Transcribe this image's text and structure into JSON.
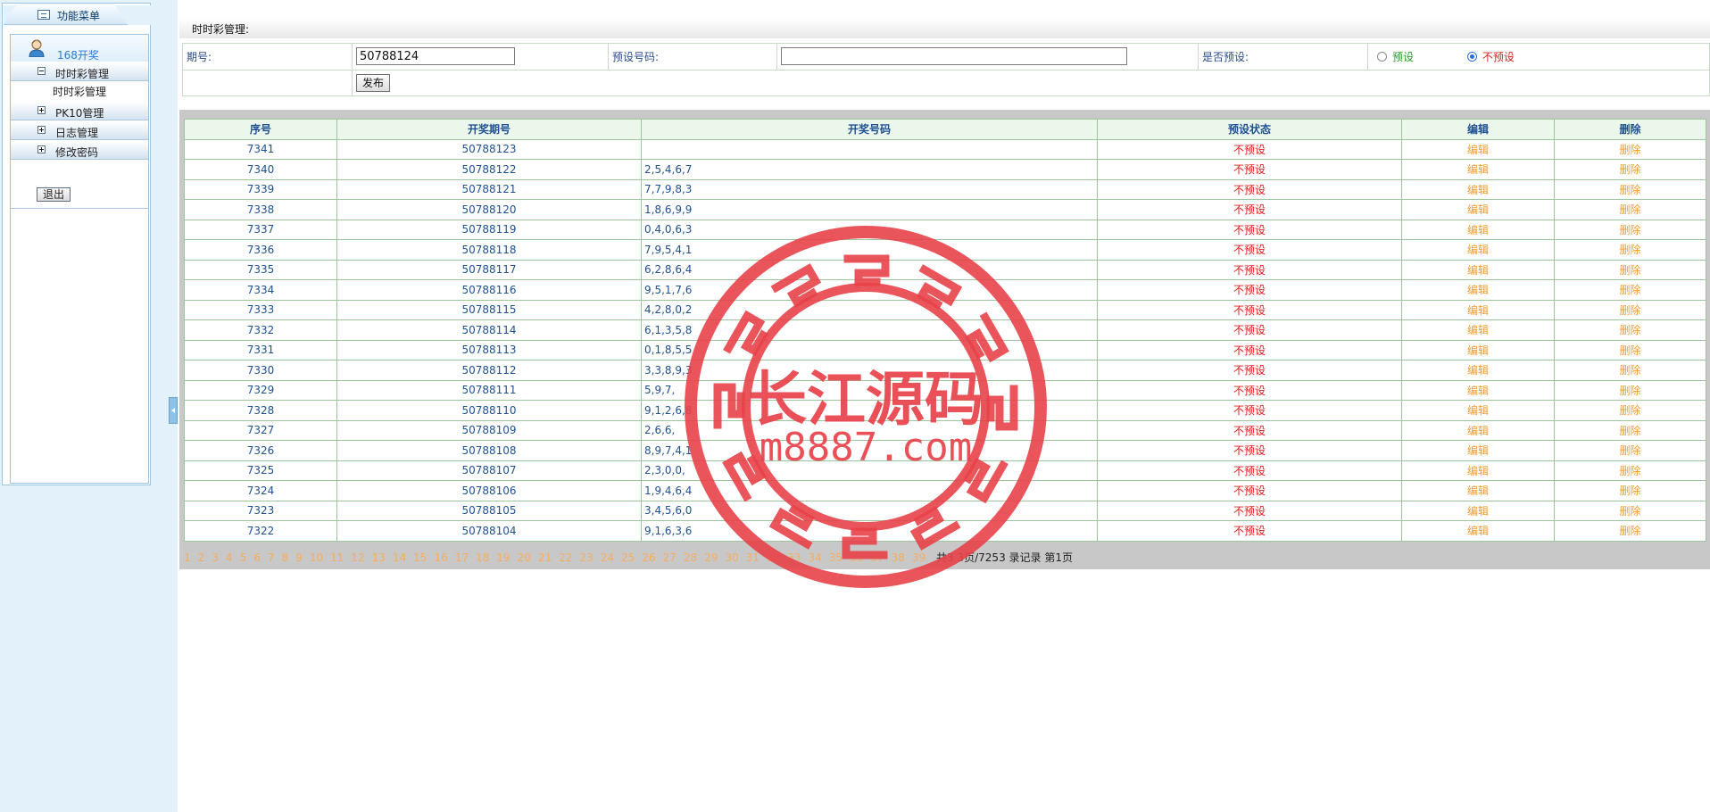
{
  "sidebar": {
    "title": "功能菜单",
    "user": "168开奖",
    "sections": [
      {
        "label": "时时彩管理",
        "expanded": true,
        "children": [
          "时时彩管理"
        ]
      },
      {
        "label": "PK10管理",
        "expanded": false
      },
      {
        "label": "日志管理",
        "expanded": false
      },
      {
        "label": "修改密码",
        "expanded": false
      }
    ],
    "logout": "退出"
  },
  "page": {
    "title": "时时彩管理:"
  },
  "form": {
    "issue_label": "期号:",
    "issue_value": "50788124",
    "preset_label": "预设号码:",
    "preset_value": "",
    "is_preset_label": "是否预设:",
    "radio_yes": "预设",
    "radio_no": "不预设",
    "selected": "不预设",
    "publish": "发布"
  },
  "table": {
    "headers": [
      "序号",
      "开奖期号",
      "开奖号码",
      "预设状态",
      "编辑",
      "删除"
    ],
    "rows": [
      {
        "id": "7341",
        "issue": "50788123",
        "nums": "",
        "status": "不预设",
        "edit": "编辑",
        "del": "删除"
      },
      {
        "id": "7340",
        "issue": "50788122",
        "nums": "2,5,4,6,7",
        "status": "不预设",
        "edit": "编辑",
        "del": "删除"
      },
      {
        "id": "7339",
        "issue": "50788121",
        "nums": "7,7,9,8,3",
        "status": "不预设",
        "edit": "编辑",
        "del": "删除"
      },
      {
        "id": "7338",
        "issue": "50788120",
        "nums": "1,8,6,9,9",
        "status": "不预设",
        "edit": "编辑",
        "del": "删除"
      },
      {
        "id": "7337",
        "issue": "50788119",
        "nums": "0,4,0,6,3",
        "status": "不预设",
        "edit": "编辑",
        "del": "删除"
      },
      {
        "id": "7336",
        "issue": "50788118",
        "nums": "7,9,5,4,1",
        "status": "不预设",
        "edit": "编辑",
        "del": "删除"
      },
      {
        "id": "7335",
        "issue": "50788117",
        "nums": "6,2,8,6,4",
        "status": "不预设",
        "edit": "编辑",
        "del": "删除"
      },
      {
        "id": "7334",
        "issue": "50788116",
        "nums": "9,5,1,7,6",
        "status": "不预设",
        "edit": "编辑",
        "del": "删除"
      },
      {
        "id": "7333",
        "issue": "50788115",
        "nums": "4,2,8,0,2",
        "status": "不预设",
        "edit": "编辑",
        "del": "删除"
      },
      {
        "id": "7332",
        "issue": "50788114",
        "nums": "6,1,3,5,8",
        "status": "不预设",
        "edit": "编辑",
        "del": "删除"
      },
      {
        "id": "7331",
        "issue": "50788113",
        "nums": "0,1,8,5,5",
        "status": "不预设",
        "edit": "编辑",
        "del": "删除"
      },
      {
        "id": "7330",
        "issue": "50788112",
        "nums": "3,3,8,9,3",
        "status": "不预设",
        "edit": "编辑",
        "del": "删除"
      },
      {
        "id": "7329",
        "issue": "50788111",
        "nums": "5,9,7,",
        "status": "不预设",
        "edit": "编辑",
        "del": "删除"
      },
      {
        "id": "7328",
        "issue": "50788110",
        "nums": "9,1,2,6,8",
        "status": "不预设",
        "edit": "编辑",
        "del": "删除"
      },
      {
        "id": "7327",
        "issue": "50788109",
        "nums": "2,6,6,",
        "status": "不预设",
        "edit": "编辑",
        "del": "删除"
      },
      {
        "id": "7326",
        "issue": "50788108",
        "nums": "8,9,7,4,1",
        "status": "不预设",
        "edit": "编辑",
        "del": "删除"
      },
      {
        "id": "7325",
        "issue": "50788107",
        "nums": "2,3,0,0,",
        "status": "不预设",
        "edit": "编辑",
        "del": "删除"
      },
      {
        "id": "7324",
        "issue": "50788106",
        "nums": "1,9,4,6,4",
        "status": "不预设",
        "edit": "编辑",
        "del": "删除"
      },
      {
        "id": "7323",
        "issue": "50788105",
        "nums": "3,4,5,6,0",
        "status": "不预设",
        "edit": "编辑",
        "del": "删除"
      },
      {
        "id": "7322",
        "issue": "50788104",
        "nums": "9,1,6,3,6",
        "status": "不预设",
        "edit": "编辑",
        "del": "删除"
      }
    ]
  },
  "pager": {
    "pages": [
      "1",
      "2",
      "3",
      "4",
      "5",
      "6",
      "7",
      "8",
      "9",
      "10",
      "11",
      "12",
      "13",
      "14",
      "15",
      "16",
      "17",
      "18",
      "19",
      "20",
      "21",
      "22",
      "23",
      "24",
      "25",
      "26",
      "27",
      "28",
      "29",
      "30",
      "31",
      "32",
      "33",
      "34",
      "35",
      "36",
      "37",
      "38",
      "39"
    ],
    "info": "共3 3页/7253 录记录 第1页"
  },
  "watermark": {
    "name": "长江源码",
    "url": "m8887.com"
  },
  "colors": {
    "sidebar_bg": "#e3f1fb",
    "header_text": "#1f5192",
    "status_red": "#e41b1b",
    "action_orange": "#f29b2e",
    "watermark_red": "#e8424a"
  }
}
